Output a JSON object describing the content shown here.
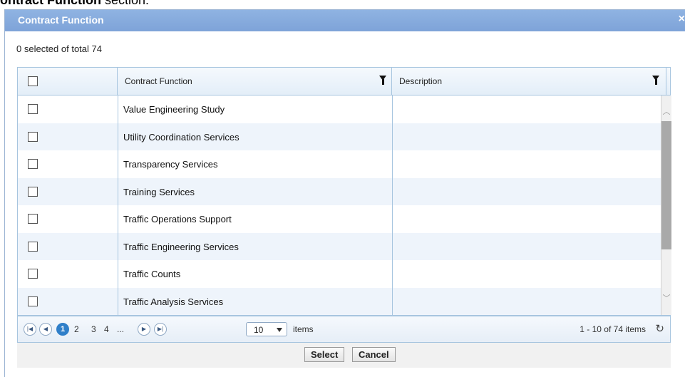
{
  "page": {
    "caption_text": "ontract Function",
    "caption_suffix": " section."
  },
  "dialog": {
    "title": "Contract Function",
    "close_label": "×"
  },
  "selection": {
    "status": "0 selected of total 74"
  },
  "table": {
    "columns": [
      "Contract Function",
      "Description"
    ],
    "rows": [
      {
        "name": "Value Engineering Study",
        "description": ""
      },
      {
        "name": "Utility Coordination Services",
        "description": ""
      },
      {
        "name": "Transparency Services",
        "description": ""
      },
      {
        "name": "Training Services",
        "description": ""
      },
      {
        "name": "Traffic Operations Support",
        "description": ""
      },
      {
        "name": "Traffic Engineering Services",
        "description": ""
      },
      {
        "name": "Traffic Counts",
        "description": ""
      },
      {
        "name": "Traffic Analysis Services",
        "description": ""
      }
    ]
  },
  "pager": {
    "first_icon": "first-page-icon",
    "prev_icon": "prev-page-icon",
    "pages": [
      "1",
      "2",
      "3",
      "4",
      "..."
    ],
    "current_page": "1",
    "next_icon": "next-page-icon",
    "last_icon": "last-page-icon",
    "page_size": "10",
    "items_label": "items",
    "info": "1 - 10 of 74 items",
    "refresh_icon": "refresh-icon"
  },
  "footer": {
    "select_label": "Select",
    "cancel_label": "Cancel"
  },
  "colors": {
    "title_bar": "#7ea3d8",
    "active_page": "#2f7fc9",
    "row_alt": "#eef4fb"
  }
}
